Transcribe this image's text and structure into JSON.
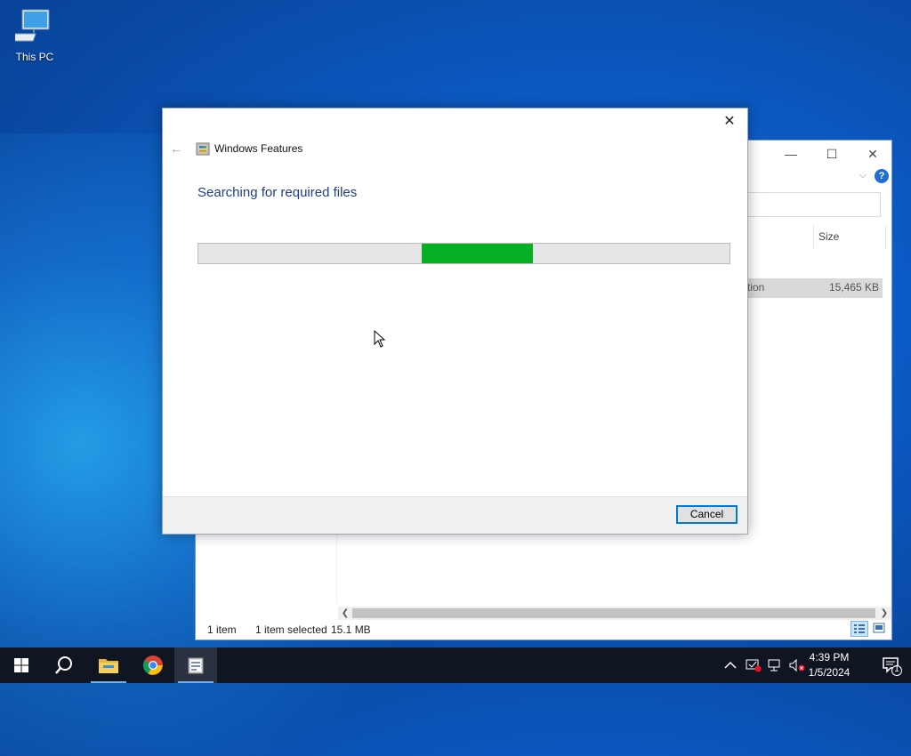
{
  "desktop": {
    "icons": [
      {
        "label": "This PC",
        "icon": "computer-icon"
      }
    ]
  },
  "explorer": {
    "column_header_size": "Size",
    "row": {
      "type_partial": "tion",
      "size": "15,465 KB"
    },
    "status": {
      "items": "1 item",
      "selected": "1 item selected",
      "size": "15.1 MB"
    },
    "window_controls": {
      "minimize": "—",
      "maximize": "☐",
      "close": "✕"
    }
  },
  "dialog": {
    "app_title": "Windows Features",
    "heading": "Searching for required files",
    "progress": {
      "indeterminate": true,
      "segment_start_fraction": 0.42,
      "segment_end_fraction": 0.63,
      "color": "#06b025"
    },
    "cancel_label": "Cancel",
    "close_label": "✕",
    "back_label": "←"
  },
  "taskbar": {
    "items": [
      {
        "name": "start-button",
        "icon": "windows-logo-icon"
      },
      {
        "name": "search-button",
        "icon": "search-icon"
      },
      {
        "name": "file-explorer",
        "icon": "folder-icon"
      },
      {
        "name": "chrome",
        "icon": "chrome-icon"
      },
      {
        "name": "windows-features",
        "icon": "windows-features-icon"
      }
    ],
    "clock": {
      "time": "4:39 PM",
      "date": "1/5/2024"
    },
    "notification_count": "1"
  }
}
